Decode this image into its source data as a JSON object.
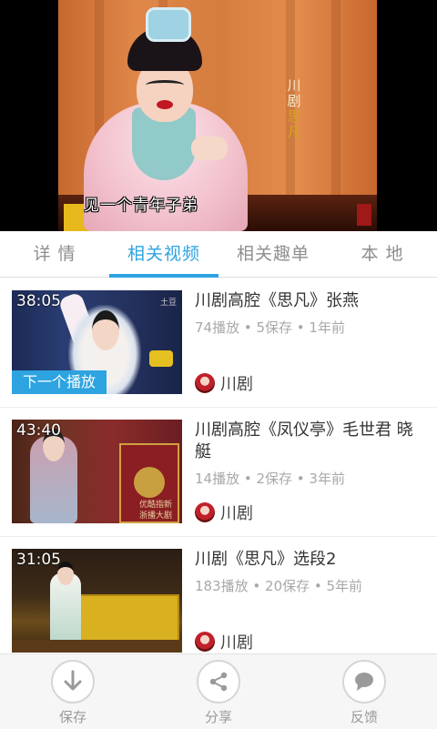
{
  "player": {
    "vertical_title": [
      "川",
      "剧",
      "思",
      "凡"
    ],
    "subtitle": "见一个青年子弟"
  },
  "tabs": [
    {
      "label": "详 情",
      "active": false
    },
    {
      "label": "相关视频",
      "active": true
    },
    {
      "label": "相关趣单",
      "active": false
    },
    {
      "label": "本 地",
      "active": false
    }
  ],
  "videos": [
    {
      "duration": "38:05",
      "title": "川剧高腔《思凡》张燕",
      "plays": "74播放",
      "saves": "5保存",
      "age": "1年前",
      "author": "川剧",
      "next_label": "下一个播放",
      "thumb_badge": "土豆"
    },
    {
      "duration": "43:40",
      "title": "川剧高腔《凤仪亭》毛世君 晓艇",
      "plays": "14播放",
      "saves": "2保存",
      "age": "3年前",
      "author": "川剧",
      "thumb_wm1": "优酷指新",
      "thumb_wm2": "浙播大剧"
    },
    {
      "duration": "31:05",
      "title": "川剧《思凡》选段2",
      "plays": "183播放",
      "saves": "20保存",
      "age": "5年前",
      "author": "川剧"
    }
  ],
  "actions": [
    {
      "label": "保存",
      "icon": "download-icon"
    },
    {
      "label": "分享",
      "icon": "share-icon"
    },
    {
      "label": "反馈",
      "icon": "chat-bubble-icon"
    }
  ],
  "colors": {
    "accent": "#2da3e0",
    "tab_inactive": "#8e8e8e",
    "meta": "#a8a8a8"
  },
  "meta_separator": " • "
}
